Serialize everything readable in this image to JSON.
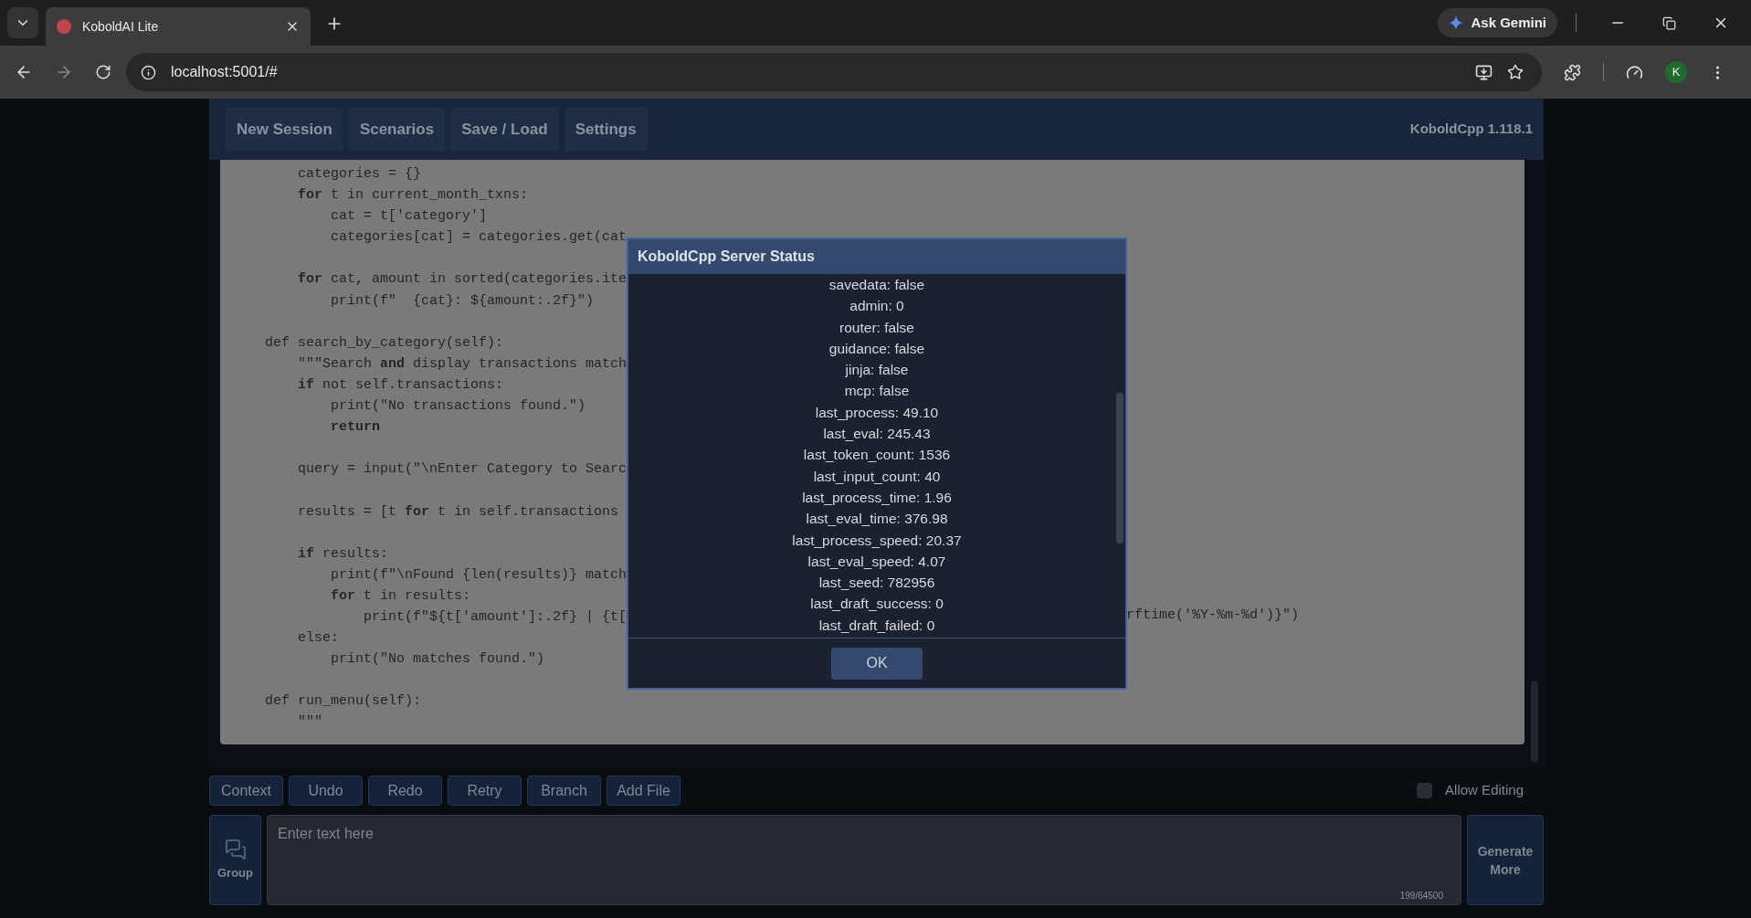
{
  "browser": {
    "tab_title": "KoboldAI Lite",
    "url": "localhost:5001/#",
    "gemini_button": "Ask Gemini",
    "profile_initial": "K"
  },
  "nav": {
    "items": [
      "New Session",
      "Scenarios",
      "Save / Load",
      "Settings"
    ],
    "version": "KoboldCpp 1.118.1"
  },
  "code_lines": [
    {
      "kind": "code",
      "text": "        categories = {}"
    },
    {
      "kind": "code",
      "text": "        **for** t in current_month_txns:"
    },
    {
      "kind": "code",
      "text": "            cat = t['category']"
    },
    {
      "kind": "code",
      "text": "            categories[cat] = categories.get(cat"
    },
    {
      "kind": "blank"
    },
    {
      "kind": "code",
      "text": "        **for** cat, amount in sorted(categories.ite"
    },
    {
      "kind": "code",
      "text": "            print(f\"  {cat}: ${amount:.2f}\")"
    },
    {
      "kind": "blank"
    },
    {
      "kind": "code",
      "text": "    def search_by_category(self):"
    },
    {
      "kind": "code",
      "text": "        \"\"\"Search **and** display transactions match"
    },
    {
      "kind": "code",
      "text": "        **if** not self.transactions:"
    },
    {
      "kind": "code",
      "text": "            print(\"No transactions found.\")"
    },
    {
      "kind": "code",
      "text": "            **return**"
    },
    {
      "kind": "blank"
    },
    {
      "kind": "code",
      "text": "        query = input(\"\\nEnter Category to Searc"
    },
    {
      "kind": "blank"
    },
    {
      "kind": "code",
      "text": "        results = [t **for** t in self.transactions"
    },
    {
      "kind": "blank"
    },
    {
      "kind": "code",
      "text": "        **if** results:"
    },
    {
      "kind": "code",
      "text": "            print(f\"\\nFound {len(results)} match"
    },
    {
      "kind": "code",
      "text": "            **for** t in results:"
    },
    {
      "kind": "code",
      "text": "                print(f\"${t['amount']:.2f} | {t[",
      "tail": "rftime('%Y-%m-%d')}\")"
    },
    {
      "kind": "code",
      "text": "        else:"
    },
    {
      "kind": "code",
      "text": "            print(\"No matches found.\")"
    },
    {
      "kind": "blank"
    },
    {
      "kind": "code",
      "text": "    def run_menu(self):"
    },
    {
      "kind": "code",
      "text": "        \"\"\""
    }
  ],
  "dialog": {
    "title": "KoboldCpp Server Status",
    "rows": [
      "savedata: false",
      "admin: 0",
      "router: false",
      "guidance: false",
      "jinja: false",
      "mcp: false",
      "last_process: 49.10",
      "last_eval: 245.43",
      "last_token_count: 1536",
      "last_input_count: 40",
      "last_process_time: 1.96",
      "last_eval_time: 376.98",
      "last_process_speed: 20.37",
      "last_eval_speed: 4.07",
      "last_seed: 782956",
      "last_draft_success: 0",
      "last_draft_failed: 0"
    ],
    "ok": "OK"
  },
  "actions": [
    "Context",
    "Undo",
    "Redo",
    "Retry",
    "Branch",
    "Add File"
  ],
  "allow_editing": {
    "label": "Allow Editing",
    "checked": false
  },
  "input": {
    "placeholder": "Enter text here",
    "counter": "199/64500"
  },
  "group_button": "Group",
  "generate_button": "Generate More"
}
